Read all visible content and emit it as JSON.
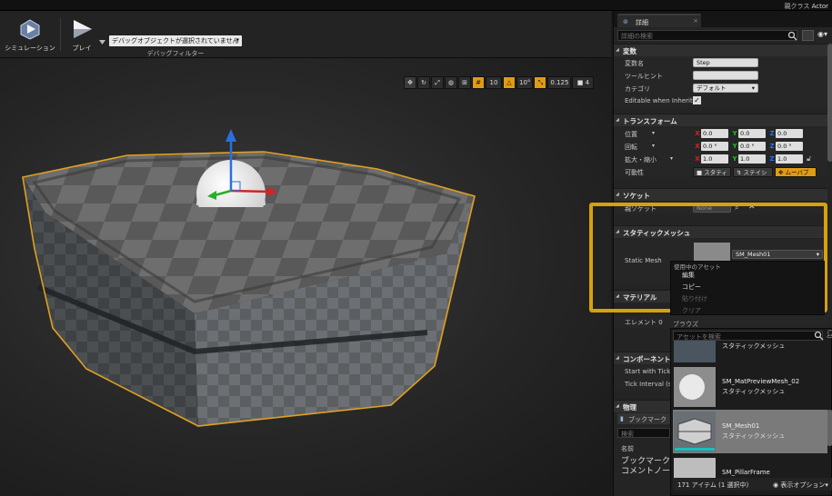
{
  "topbar": {
    "parent_class_label": "親クラス",
    "parent_class_value": "Actor"
  },
  "toolbar": {
    "simulation_label": "シミュレーション",
    "play_label": "プレイ",
    "debug_select_value": "デバッグオブジェクトが選択されていません",
    "debug_filter_caption": "デバッグフィルター"
  },
  "viewport_tools": {
    "grid_snap": "10",
    "rot_snap": "10°",
    "scale_snap": "0.125",
    "cam_speed": "4"
  },
  "details": {
    "tab_title": "詳細",
    "search_placeholder": "詳細の検索",
    "sections": {
      "variable": "変数",
      "transform": "トランスフォーム",
      "socket": "ソケット",
      "static_mesh": "スタティックメッシュ",
      "material": "マテリアル",
      "components": "コンポーネント",
      "physics": "物理"
    },
    "variable": {
      "name_label": "変数名",
      "name_value": "Step",
      "tooltip_label": "ツールヒント",
      "category_label": "カテゴリ",
      "category_value": "デフォルト",
      "editable_label": "Editable when Inherited"
    },
    "transform": {
      "location_label": "位置",
      "rotation_label": "回転",
      "scale_label": "拡大・縮小",
      "location": [
        "0.0",
        "0.0",
        "0.0"
      ],
      "rotation": [
        "0.0 °",
        "0.0 °",
        "0.0 °"
      ],
      "scale": [
        "1.0",
        "1.0",
        "1.0"
      ],
      "mobility_label": "可動性",
      "mobility": [
        "スタティ",
        "ステイシ",
        "ムーバブ"
      ]
    },
    "socket": {
      "parent_socket_label": "親ソケット",
      "parent_socket_value": "None"
    },
    "static_mesh": {
      "label": "Static Mesh",
      "value": "SM_Mesh01"
    },
    "material": {
      "element0_label": "エレメント 0"
    },
    "components": {
      "tick_label_1": "Start with Tick En",
      "tick_label_2": "Tick Interval (sec"
    },
    "bookmarks": {
      "title": "ブックマーク",
      "search_placeholder": "検索",
      "column": "名前",
      "items": [
        "ブックマーク",
        "コメントノード"
      ]
    }
  },
  "context_menu": {
    "header": "使用中のアセット",
    "items": [
      "編集",
      "コピー",
      "貼り付け",
      "クリア"
    ],
    "browse_label": "ブラウズ"
  },
  "asset_picker": {
    "search_placeholder": "アセットを検索",
    "assets": [
      {
        "name": "",
        "type": "スタティックメッシュ"
      },
      {
        "name": "SM_MatPreviewMesh_02",
        "type": "スタティックメッシュ"
      },
      {
        "name": "SM_Mesh01",
        "type": "スタティックメッシュ"
      },
      {
        "name": "SM_PillarFrame",
        "type": ""
      }
    ],
    "footer_count": "171 アイテム (1 選択中)",
    "footer_options": "表示オプション"
  },
  "colors": {
    "accent_orange": "#e09b14",
    "highlight_gold": "#d6a20a",
    "selection_outline": "#e0a020"
  }
}
